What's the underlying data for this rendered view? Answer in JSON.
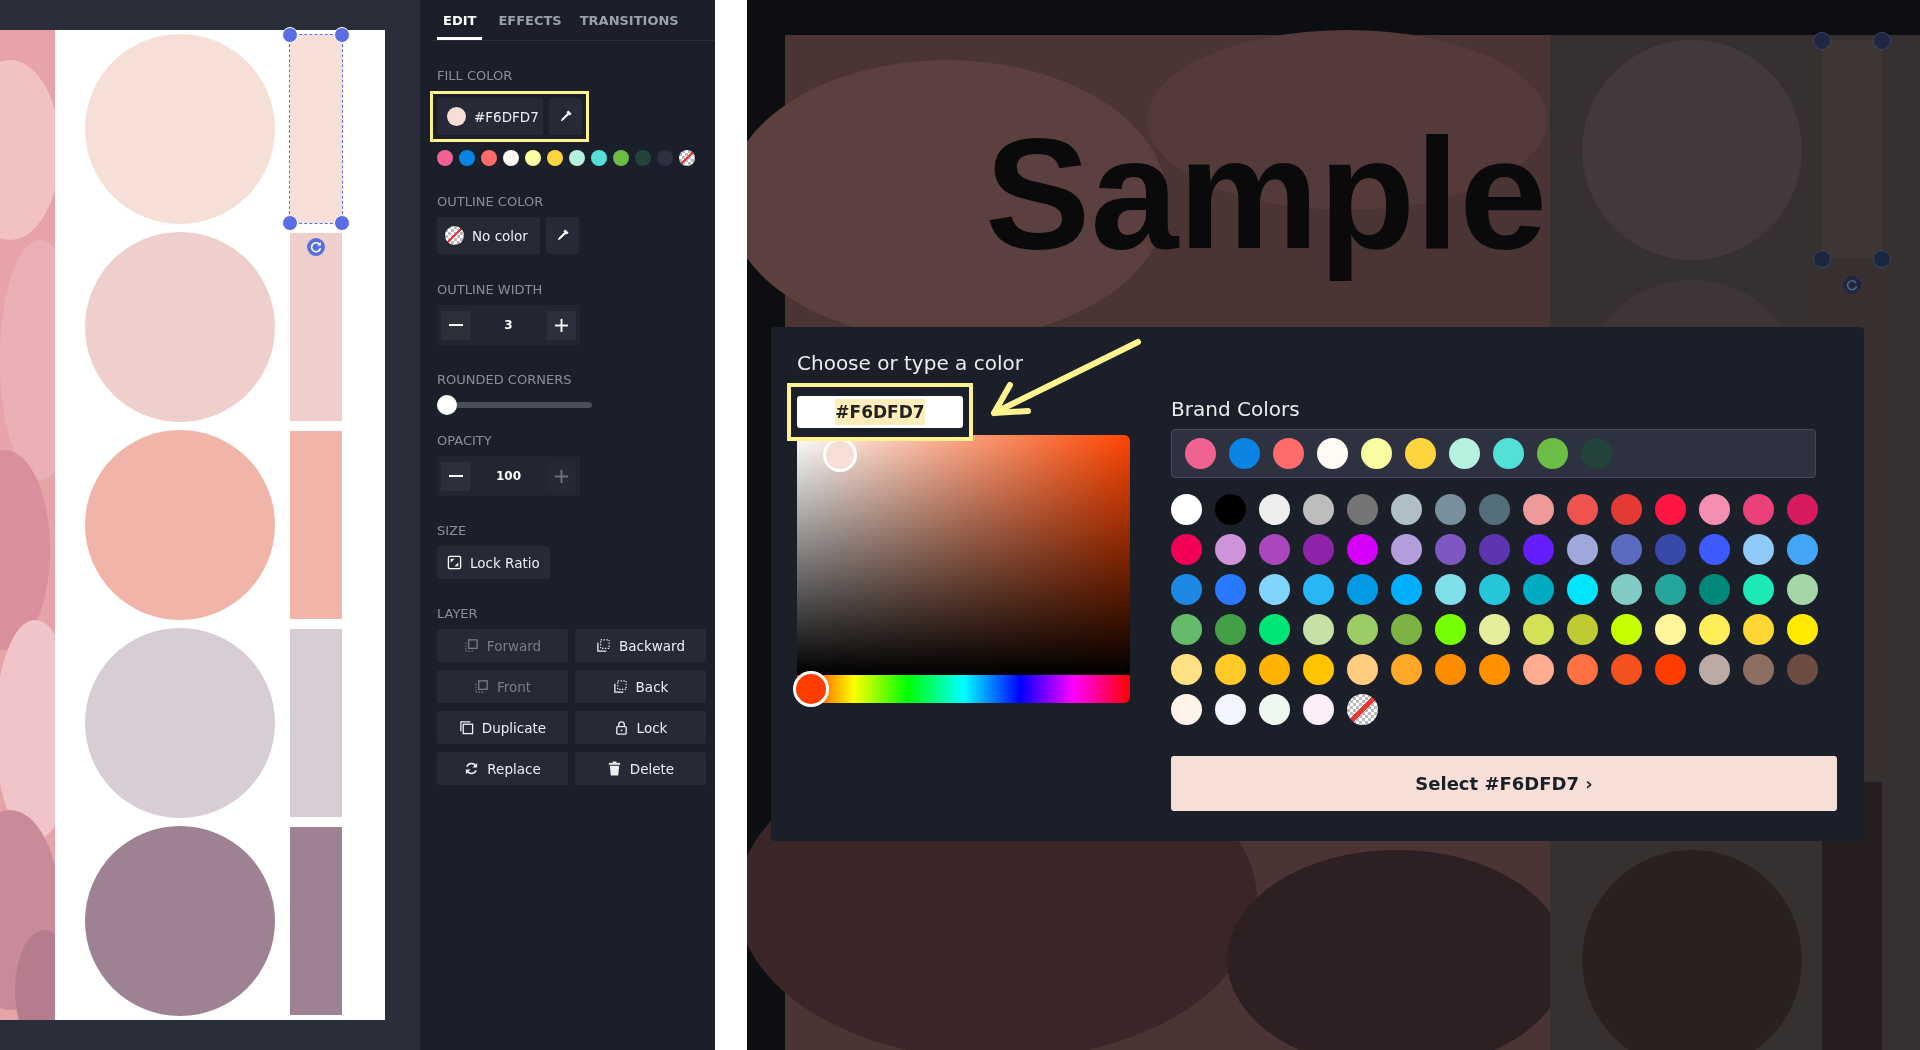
{
  "canvas": {
    "shapes": [
      {
        "color": "#f6dfd7",
        "selected": true
      },
      {
        "color": "#efcfcb",
        "selected": false
      },
      {
        "color": "#f0b5a8",
        "selected": false
      },
      {
        "color": "#d8cdd5",
        "selected": false
      },
      {
        "color": "#9e8294",
        "selected": false
      }
    ]
  },
  "editor": {
    "tabs": [
      {
        "label": "EDIT",
        "selected": true
      },
      {
        "label": "EFFECTS",
        "selected": false
      },
      {
        "label": "TRANSITIONS",
        "selected": false
      }
    ],
    "fill_color": {
      "label": "FILL COLOR",
      "value": "#F6DFD7",
      "color": "#f6dfd7"
    },
    "swatches": [
      {
        "kind": "color",
        "color": "#f06292"
      },
      {
        "kind": "color",
        "color": "#0984e3"
      },
      {
        "kind": "color",
        "color": "#ff6b6b"
      },
      {
        "kind": "color",
        "color": "#fffaf3"
      },
      {
        "kind": "color",
        "color": "#f9fca0"
      },
      {
        "kind": "color",
        "color": "#fed43f"
      },
      {
        "kind": "color",
        "color": "#b6f1e0"
      },
      {
        "kind": "color",
        "color": "#52e0d8"
      },
      {
        "kind": "color",
        "color": "#6bbd45"
      },
      {
        "kind": "color",
        "color": "#22443a"
      },
      {
        "kind": "color",
        "color": "#2d3040"
      },
      {
        "kind": "none"
      }
    ],
    "outline_color": {
      "label": "OUTLINE COLOR",
      "value": "No color"
    },
    "outline_width": {
      "label": "OUTLINE WIDTH",
      "value": "3",
      "plus_disabled": false
    },
    "rounded_corners": {
      "label": "ROUNDED CORNERS",
      "level": 0
    },
    "opacity": {
      "label": "OPACITY",
      "value": "100",
      "plus_disabled": true
    },
    "size": {
      "label": "SIZE",
      "button": "Lock Ratio"
    },
    "layer": {
      "label": "LAYER",
      "buttons": [
        {
          "label": "Forward",
          "disabled": true
        },
        {
          "label": "Backward",
          "disabled": false
        },
        {
          "label": "Front",
          "disabled": true
        },
        {
          "label": "Back",
          "disabled": false
        },
        {
          "label": "Duplicate",
          "disabled": false
        },
        {
          "label": "Lock",
          "disabled": false
        },
        {
          "label": "Replace",
          "disabled": false
        },
        {
          "label": "Delete",
          "disabled": false
        }
      ]
    }
  },
  "preview": {
    "heading": "Sample"
  },
  "color_dialog": {
    "title": "Choose or type a color",
    "hex_value": "#F6DFD7",
    "hue_slider": {
      "level": 0.02
    },
    "brand_title": "Brand Colors",
    "brand_colors": [
      {
        "color": "#f06292"
      },
      {
        "color": "#0984e3"
      },
      {
        "color": "#ff6b6b"
      },
      {
        "color": "#fffaf3"
      },
      {
        "color": "#f9fca0"
      },
      {
        "color": "#fed43f"
      },
      {
        "color": "#b6f1e0"
      },
      {
        "color": "#52e0d8"
      },
      {
        "color": "#6bbd45"
      },
      {
        "color": "#22443a"
      }
    ],
    "palette": [
      {
        "kind": "color",
        "color": "#ffffff"
      },
      {
        "kind": "color",
        "color": "#000000"
      },
      {
        "kind": "color",
        "color": "#eeeeee"
      },
      {
        "kind": "color",
        "color": "#bdbdbd"
      },
      {
        "kind": "color",
        "color": "#757575"
      },
      {
        "kind": "color",
        "color": "#b0bec5"
      },
      {
        "kind": "color",
        "color": "#78909c"
      },
      {
        "kind": "color",
        "color": "#546e7a"
      },
      {
        "kind": "color",
        "color": "#ef9a9a"
      },
      {
        "kind": "color",
        "color": "#ef5350"
      },
      {
        "kind": "color",
        "color": "#e53935"
      },
      {
        "kind": "color",
        "color": "#ff1744"
      },
      {
        "kind": "color",
        "color": "#f48fb1"
      },
      {
        "kind": "color",
        "color": "#ec407a"
      },
      {
        "kind": "color",
        "color": "#d81b60"
      },
      {
        "kind": "color",
        "color": "#f50057"
      },
      {
        "kind": "color",
        "color": "#ce93d8"
      },
      {
        "kind": "color",
        "color": "#ab47bc"
      },
      {
        "kind": "color",
        "color": "#8e24aa"
      },
      {
        "kind": "color",
        "color": "#d500f9"
      },
      {
        "kind": "color",
        "color": "#b39ddb"
      },
      {
        "kind": "color",
        "color": "#7e57c2"
      },
      {
        "kind": "color",
        "color": "#5e35b1"
      },
      {
        "kind": "color",
        "color": "#651fff"
      },
      {
        "kind": "color",
        "color": "#9fa8da"
      },
      {
        "kind": "color",
        "color": "#5c6bc0"
      },
      {
        "kind": "color",
        "color": "#3949ab"
      },
      {
        "kind": "color",
        "color": "#3d5afe"
      },
      {
        "kind": "color",
        "color": "#90caf9"
      },
      {
        "kind": "color",
        "color": "#42a5f5"
      },
      {
        "kind": "color",
        "color": "#1e88e5"
      },
      {
        "kind": "color",
        "color": "#2979ff"
      },
      {
        "kind": "color",
        "color": "#81d4fa"
      },
      {
        "kind": "color",
        "color": "#29b6f6"
      },
      {
        "kind": "color",
        "color": "#039be5"
      },
      {
        "kind": "color",
        "color": "#00b0ff"
      },
      {
        "kind": "color",
        "color": "#80deea"
      },
      {
        "kind": "color",
        "color": "#26c6da"
      },
      {
        "kind": "color",
        "color": "#00acc1"
      },
      {
        "kind": "color",
        "color": "#00e5ff"
      },
      {
        "kind": "color",
        "color": "#80cbc4"
      },
      {
        "kind": "color",
        "color": "#26a69a"
      },
      {
        "kind": "color",
        "color": "#00897b"
      },
      {
        "kind": "color",
        "color": "#1de9b6"
      },
      {
        "kind": "color",
        "color": "#a5d6a7"
      },
      {
        "kind": "color",
        "color": "#66bb6a"
      },
      {
        "kind": "color",
        "color": "#43a047"
      },
      {
        "kind": "color",
        "color": "#00e676"
      },
      {
        "kind": "color",
        "color": "#c5e1a5"
      },
      {
        "kind": "color",
        "color": "#9ccc65"
      },
      {
        "kind": "color",
        "color": "#7cb342"
      },
      {
        "kind": "color",
        "color": "#76ff03"
      },
      {
        "kind": "color",
        "color": "#e6ee9c"
      },
      {
        "kind": "color",
        "color": "#d4e157"
      },
      {
        "kind": "color",
        "color": "#c0ca33"
      },
      {
        "kind": "color",
        "color": "#c6ff00"
      },
      {
        "kind": "color",
        "color": "#fff59d"
      },
      {
        "kind": "color",
        "color": "#ffee58"
      },
      {
        "kind": "color",
        "color": "#fdd835"
      },
      {
        "kind": "color",
        "color": "#ffea00"
      },
      {
        "kind": "color",
        "color": "#ffe082"
      },
      {
        "kind": "color",
        "color": "#ffca28"
      },
      {
        "kind": "color",
        "color": "#ffb300"
      },
      {
        "kind": "color",
        "color": "#ffc400"
      },
      {
        "kind": "color",
        "color": "#ffcc80"
      },
      {
        "kind": "color",
        "color": "#ffa726"
      },
      {
        "kind": "color",
        "color": "#fb8c00"
      },
      {
        "kind": "color",
        "color": "#ff9100"
      },
      {
        "kind": "color",
        "color": "#ffab91"
      },
      {
        "kind": "color",
        "color": "#ff7043"
      },
      {
        "kind": "color",
        "color": "#f4511e"
      },
      {
        "kind": "color",
        "color": "#ff3d00"
      },
      {
        "kind": "color",
        "color": "#bcaaa4"
      },
      {
        "kind": "color",
        "color": "#8d6e63"
      },
      {
        "kind": "color",
        "color": "#6d4c41"
      },
      {
        "kind": "color",
        "color": "#fff3e9"
      },
      {
        "kind": "color",
        "color": "#f5f5ff"
      },
      {
        "kind": "color",
        "color": "#eff8ef"
      },
      {
        "kind": "color",
        "color": "#fbeef8"
      },
      {
        "kind": "none"
      }
    ],
    "select_button": {
      "label": "Select #F6DFD7",
      "chevron": "›",
      "color": "#f6dfd7"
    }
  }
}
